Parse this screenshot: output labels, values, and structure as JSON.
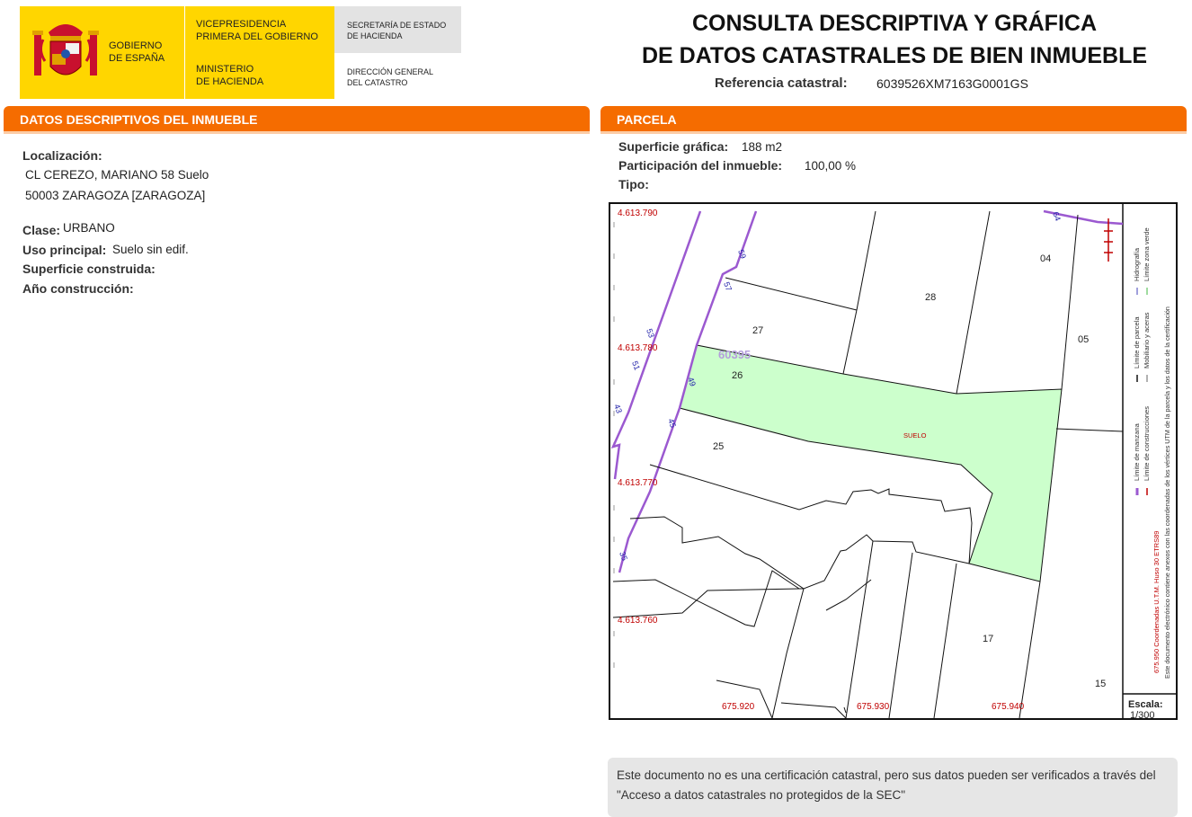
{
  "header": {
    "gov_line1": "GOBIERNO",
    "gov_line2": "DE ESPAÑA",
    "vice_line1": "VICEPRESIDENCIA",
    "vice_line2": "PRIMERA DEL GOBIERNO",
    "min_line1": "MINISTERIO",
    "min_line2": "DE HACIENDA",
    "sec_line1": "SECRETARÍA DE ESTADO",
    "sec_line2": "DE HACIENDA",
    "dir_line1": "DIRECCIÓN GENERAL",
    "dir_line2": "DEL CATASTRO",
    "title_line1": "CONSULTA DESCRIPTIVA Y GRÁFICA",
    "title_line2": "DE DATOS CATASTRALES DE BIEN INMUEBLE",
    "ref_label": "Referencia catastral:",
    "ref_value": "6039526XM7163G0001GS"
  },
  "descriptive": {
    "heading": "DATOS DESCRIPTIVOS DEL INMUEBLE",
    "loc_label": "Localización:",
    "loc_line1": "CL CEREZO, MARIANO 58 Suelo",
    "loc_line2": "50003 ZARAGOZA [ZARAGOZA]",
    "clase_label": "Clase:",
    "clase_value": "URBANO",
    "uso_label": "Uso principal:",
    "uso_value": "Suelo sin edif.",
    "sup_label": "Superficie construida:",
    "anio_label": "Año construcción:"
  },
  "parcela": {
    "heading": "PARCELA",
    "sup_label": "Superficie gráfica:",
    "sup_value": "188 m2",
    "part_label": "Participación del inmueble:",
    "part_value": "100,00 %",
    "tipo_label": "Tipo:"
  },
  "map": {
    "northings": [
      "4.613.790",
      "4.613.780",
      "4.613.770",
      "4.613.760"
    ],
    "eastings": [
      "675.920",
      "675.930",
      "675.940"
    ],
    "parcel_numbers": [
      "04",
      "28",
      "27",
      "05",
      "26",
      "25",
      "17",
      "15"
    ],
    "street_numbers": [
      "59",
      "57",
      "53",
      "51",
      "49",
      "45",
      "43",
      "35",
      "64"
    ],
    "block_label": "60395",
    "suelo_label": "SUELO",
    "scale_label": "Escala:",
    "scale_value": "1/300",
    "legend": {
      "limite_manzana": "Límite de manzana",
      "limite_parcela": "Límite de parcela",
      "hidrografia": "Hidrografía",
      "limite_construcciones": "Límite de construcciones",
      "mobiliario": "Mobiliario y aceras",
      "zona_verde": "Límite zona verde",
      "utm_note": "675.950 Coordenadas U.T.M. Huso 30 ETRS89",
      "electronic_note": "Este documento electrónico contiene anexos con las coordenadas de los vértices UTM de la parcela y los datos de la certificación"
    },
    "colors": {
      "manzana": "#9b59d0",
      "parcel_fill": "#ccffcc",
      "coord_red": "#c00000",
      "street_blue": "#2222aa"
    }
  },
  "notice": {
    "text": "Este documento no es una certificación catastral, pero sus datos pueden ser verificados a través del \"Acceso a datos catastrales no protegidos de la SEC\""
  }
}
